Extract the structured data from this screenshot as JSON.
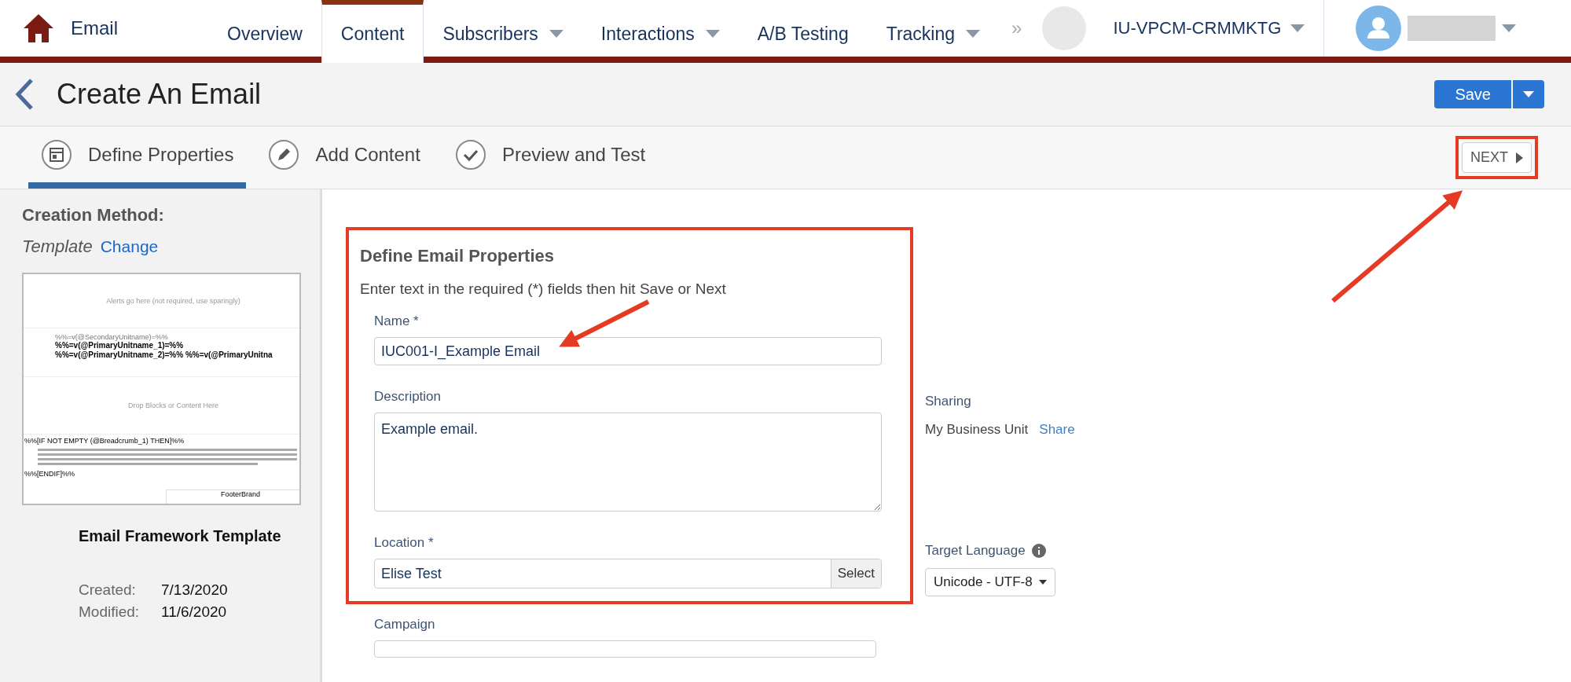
{
  "nav": {
    "app_name": "Email",
    "items": [
      {
        "label": "Overview",
        "selected": false,
        "dropdown": false
      },
      {
        "label": "Content",
        "selected": true,
        "dropdown": false
      },
      {
        "label": "Subscribers",
        "selected": false,
        "dropdown": true
      },
      {
        "label": "Interactions",
        "selected": false,
        "dropdown": true
      },
      {
        "label": "A/B Testing",
        "selected": false,
        "dropdown": false
      },
      {
        "label": "Tracking",
        "selected": false,
        "dropdown": true
      }
    ],
    "overflow": "»",
    "account": "IU-VPCM-CRMMKTG"
  },
  "header": {
    "title": "Create An Email",
    "save": "Save"
  },
  "steps": [
    {
      "label": "Define Properties",
      "selected": true,
      "kind": "form"
    },
    {
      "label": "Add Content",
      "selected": false,
      "kind": "pencil"
    },
    {
      "label": "Preview and Test",
      "selected": false,
      "kind": "check"
    }
  ],
  "next": "NEXT",
  "sidebar": {
    "heading": "Creation Method:",
    "method": "Template",
    "change": "Change",
    "thumbnail": {
      "alert": "Alerts go here (not required, use sparingly)",
      "secondary": "%%=v(@SecondaryUnitname)=%%",
      "primary_1": "%%=v(@PrimaryUnitname_1)=%%",
      "primary_2": "%%=v(@PrimaryUnitname_2)=%% %%=v(@PrimaryUnitna",
      "drop": "Drop Blocks or Content Here",
      "if": "%%[IF NOT EMPTY (@Breadcrumb_1) THEN]%%",
      "endif": "%%[ENDIF]%%",
      "footer": "FooterBrand"
    },
    "template_name": "Email Framework Template",
    "meta": [
      {
        "label": "Created:",
        "value": "7/13/2020"
      },
      {
        "label": "Modified:",
        "value": "11/6/2020"
      }
    ]
  },
  "form": {
    "title": "Define Email Properties",
    "subtitle": "Enter text in the required (*) fields then hit Save or Next",
    "name": {
      "label": "Name *",
      "value": "IUC001-I_Example Email"
    },
    "description": {
      "label": "Description",
      "value": "Example email."
    },
    "location": {
      "label": "Location *",
      "value": "Elise Test",
      "button": "Select"
    },
    "campaign": {
      "label": "Campaign"
    },
    "sharing": {
      "label": "Sharing",
      "value": "My Business Unit",
      "link": "Share"
    },
    "language": {
      "label": "Target Language",
      "value": "Unicode - UTF-8"
    }
  }
}
